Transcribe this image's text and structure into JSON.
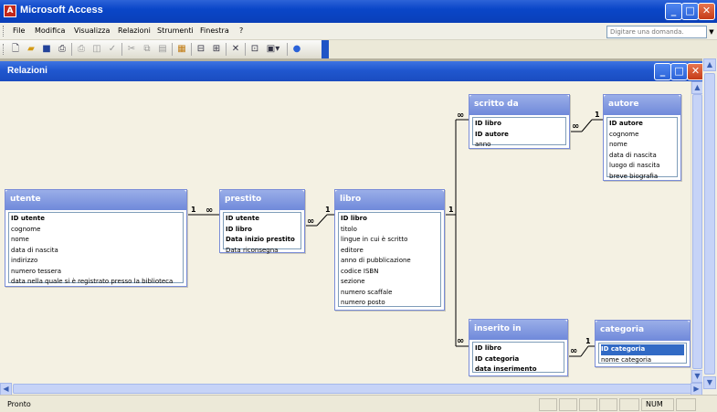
{
  "app": {
    "title": "Microsoft Access",
    "logo": "A"
  },
  "menu": [
    "File",
    "Modifica",
    "Visualizza",
    "Relazioni",
    "Strumenti",
    "Finestra",
    "?"
  ],
  "help_placeholder": "Digitare una domanda.",
  "toolbar_icons": [
    "new-icon",
    "open-icon",
    "save-icon",
    "print-preview-icon",
    "print-icon",
    "preview-icon",
    "spellcheck-icon",
    "cut-icon",
    "copy-icon",
    "paste-icon",
    "show-table-icon",
    "show-direct-icon",
    "show-all-icon",
    "delete-icon",
    "relationships-icon",
    "new-object-icon",
    "help-icon"
  ],
  "window": {
    "title": "Relazioni"
  },
  "tables": {
    "utente": {
      "name": "utente",
      "fields": [
        {
          "label": "ID utente",
          "pk": true
        },
        {
          "label": "cognome"
        },
        {
          "label": "nome"
        },
        {
          "label": "data di nascita"
        },
        {
          "label": "indirizzo"
        },
        {
          "label": "numero tessera"
        },
        {
          "label": "data nella quale si è registrato presso la biblioteca"
        }
      ]
    },
    "prestito": {
      "name": "prestito",
      "fields": [
        {
          "label": "ID utente",
          "pk": true
        },
        {
          "label": "ID libro",
          "pk": true
        },
        {
          "label": "Data inizio prestito",
          "pk": true
        },
        {
          "label": "Data riconsegna"
        }
      ]
    },
    "libro": {
      "name": "libro",
      "fields": [
        {
          "label": "ID libro",
          "pk": true
        },
        {
          "label": "titolo"
        },
        {
          "label": "lingue in cui è scritto"
        },
        {
          "label": "editore"
        },
        {
          "label": "anno di pubblicazione"
        },
        {
          "label": "codice ISBN"
        },
        {
          "label": "sezione"
        },
        {
          "label": "numero scaffale"
        },
        {
          "label": "numero posto"
        }
      ]
    },
    "scritto_da": {
      "name": "scritto da",
      "fields": [
        {
          "label": "ID libro",
          "pk": true
        },
        {
          "label": "ID autore",
          "pk": true
        },
        {
          "label": "anno"
        }
      ]
    },
    "autore": {
      "name": "autore",
      "fields": [
        {
          "label": "ID autore",
          "pk": true
        },
        {
          "label": "cognome"
        },
        {
          "label": "nome"
        },
        {
          "label": "data di nascita"
        },
        {
          "label": "luogo di nascita"
        },
        {
          "label": "breve biografia"
        }
      ]
    },
    "inserito_in": {
      "name": "inserito in",
      "fields": [
        {
          "label": "ID libro",
          "pk": true
        },
        {
          "label": "ID categoria",
          "pk": true
        },
        {
          "label": "data inserimento",
          "pk": true
        }
      ]
    },
    "categoria": {
      "name": "categoria",
      "fields": [
        {
          "label": "ID categoria",
          "pk": true,
          "selected": true
        },
        {
          "label": "nome categoria"
        }
      ]
    }
  },
  "cardinality": {
    "one": "1",
    "many": "∞"
  },
  "status": {
    "text": "Pronto",
    "num": "NUM"
  }
}
